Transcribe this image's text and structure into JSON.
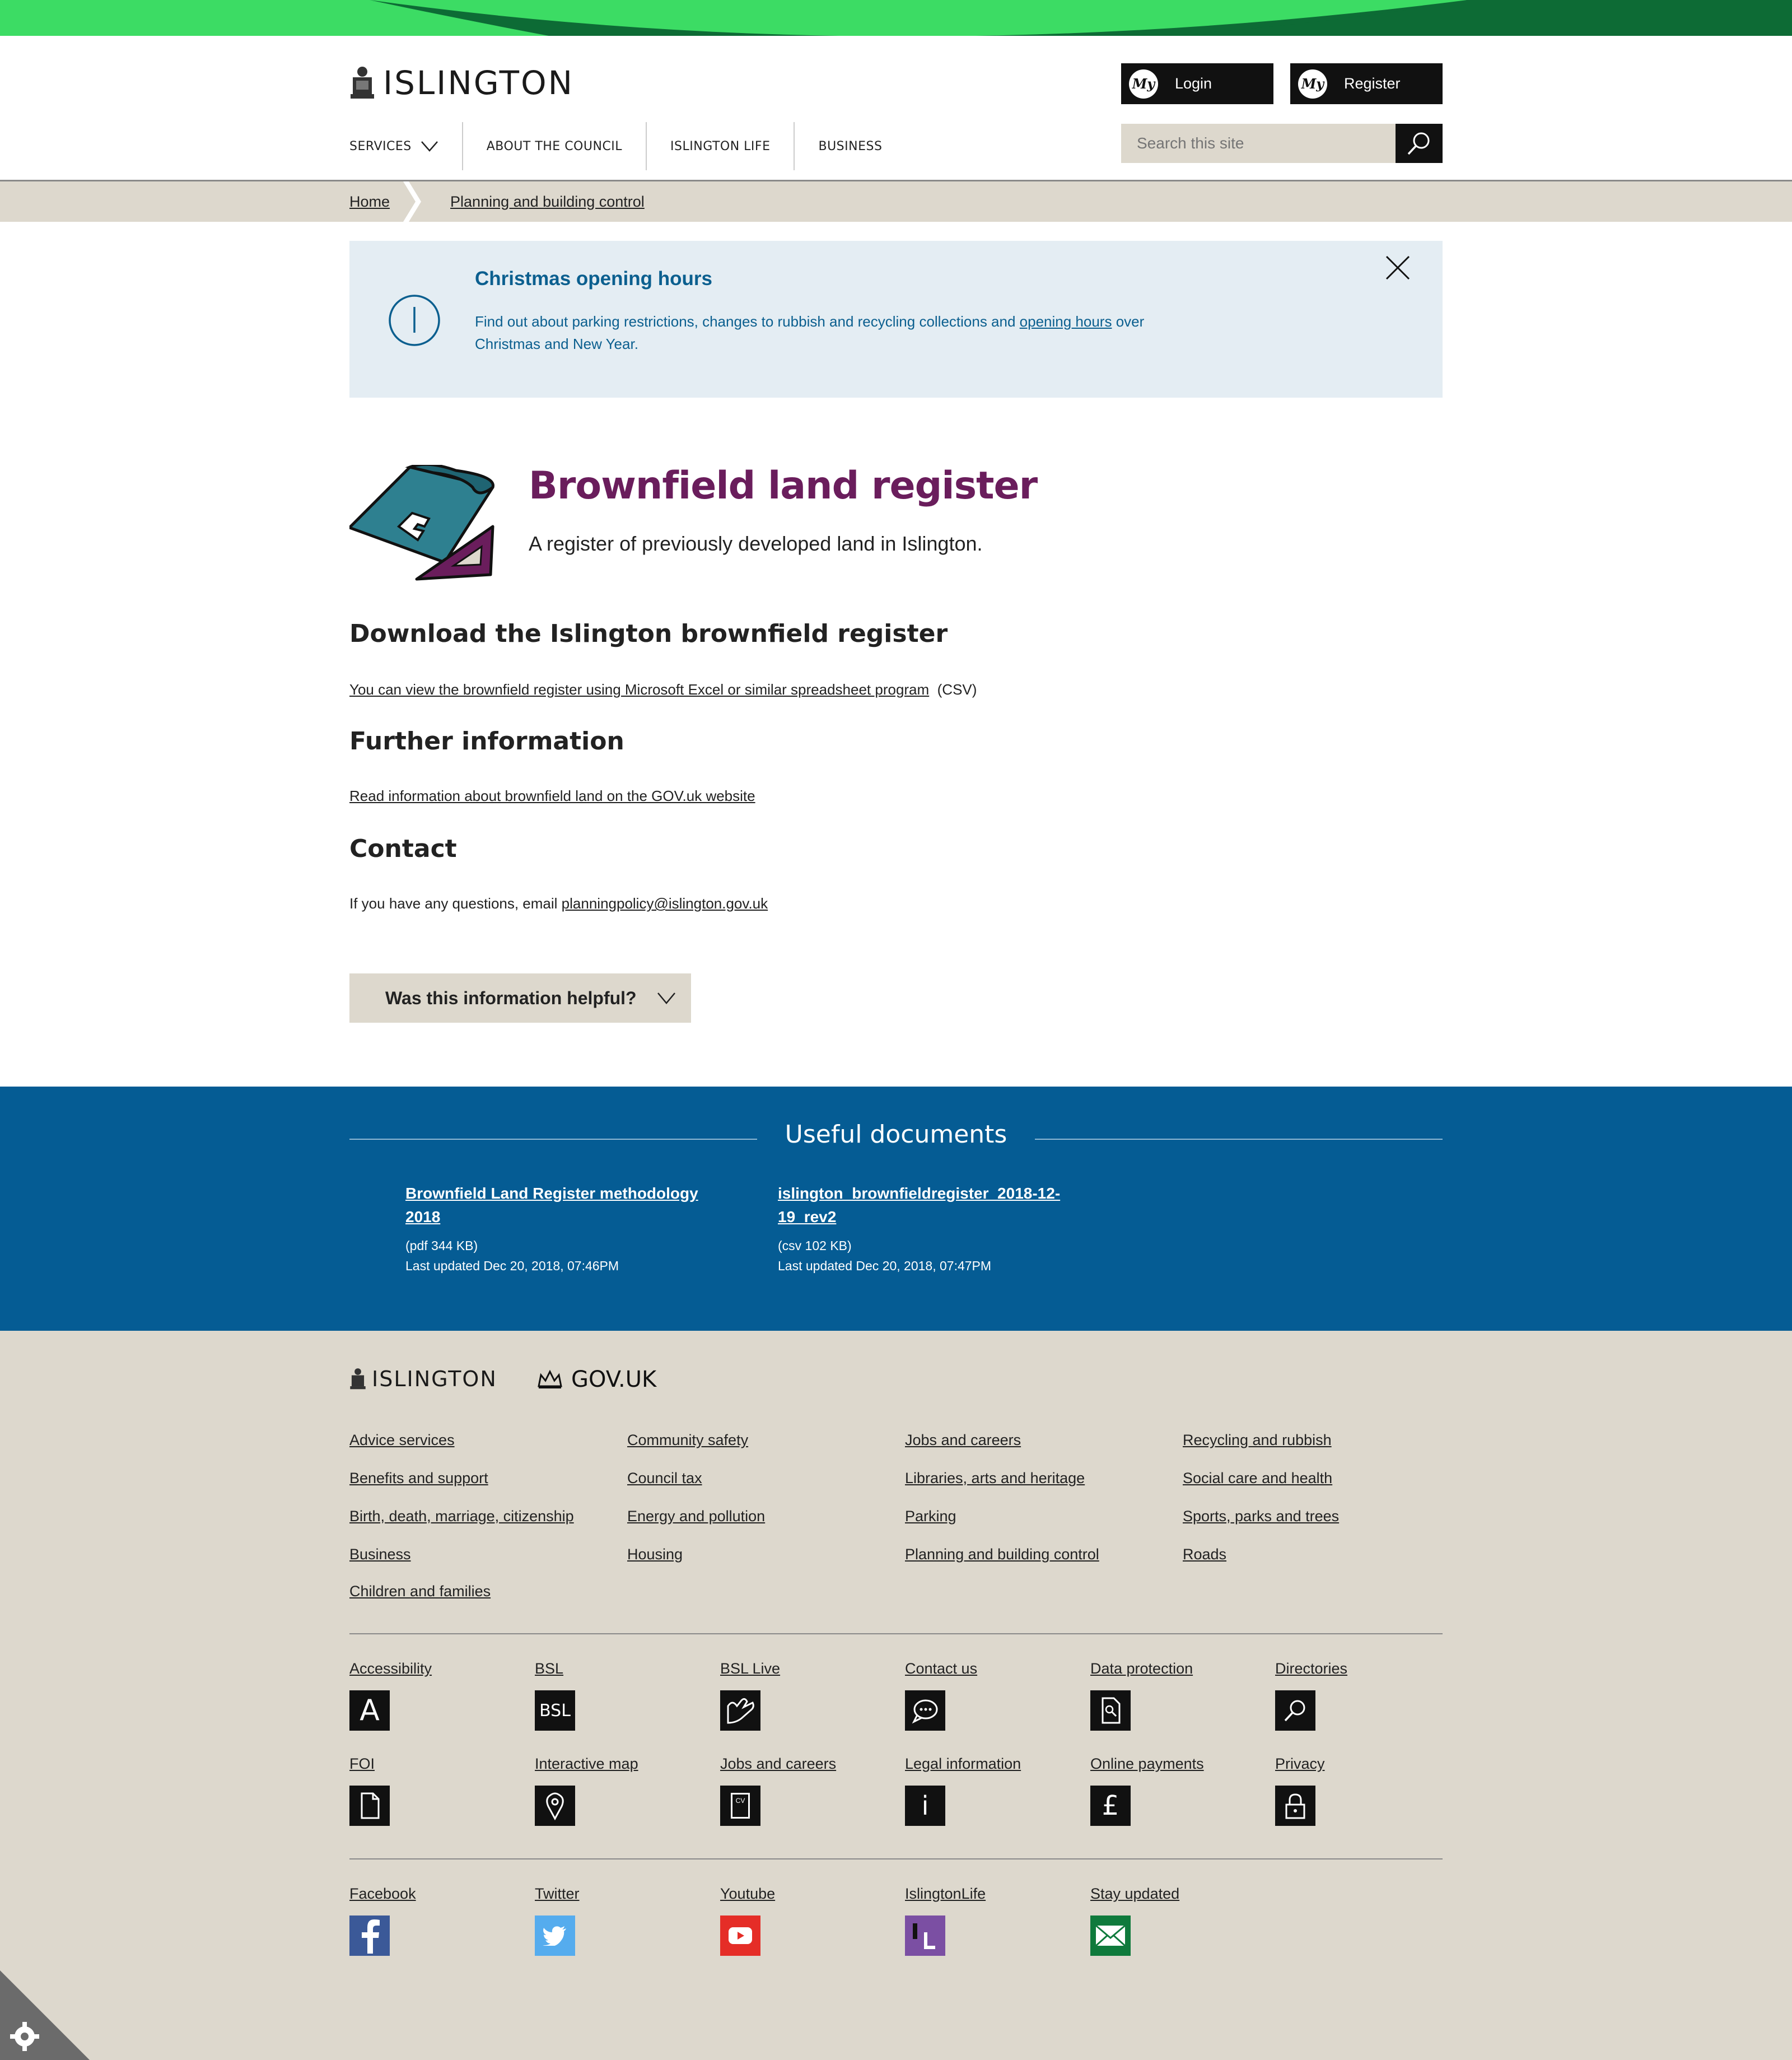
{
  "header": {
    "logo_text": "ISLINGTON",
    "login_label": "Login",
    "register_label": "Register",
    "my_badge": "My",
    "nav": [
      "SERVICES",
      "ABOUT THE COUNCIL",
      "ISLINGTON LIFE",
      "BUSINESS"
    ],
    "search_placeholder": "Search this site"
  },
  "breadcrumb": [
    "Home",
    "Planning and building control"
  ],
  "alert": {
    "title": "Christmas opening hours",
    "text_before": "Find out about parking restrictions, changes to rubbish and recycling collections and ",
    "link": "opening hours",
    "text_after": " over Christmas and New Year."
  },
  "page": {
    "title": "Brownfield land register",
    "subtitle": "A register of previously developed land in Islington.",
    "section1_heading": "Download the Islington brownfield register",
    "section1_link": "You can view the brownfield register using Microsoft Excel or similar spreadsheet program",
    "section1_suffix": "(CSV)",
    "section2_heading": "Further information",
    "section2_link": "Read information about brownfield land on the GOV.uk website",
    "section3_heading": "Contact",
    "section3_text": "If you have any questions, email ",
    "section3_email": "planningpolicy@islington.gov.uk",
    "helpful_label": "Was this information helpful?"
  },
  "documents": {
    "title": "Useful documents",
    "items": [
      {
        "name": "Brownfield Land Register methodology 2018",
        "size": "(pdf 344 KB)",
        "updated": "Last updated Dec 20, 2018, 07:46PM"
      },
      {
        "name": "islington_brownfieldregister_2018-12-19_rev2",
        "size": "(csv 102 KB)",
        "updated": "Last updated Dec 20, 2018, 07:47PM"
      }
    ]
  },
  "footer": {
    "logo_islington": "ISLINGTON",
    "logo_gov": "GOV.UK",
    "links": [
      [
        "Advice services",
        "Benefits and support",
        "Birth, death, marriage, citizenship",
        "Business",
        "Children and families"
      ],
      [
        "Community safety",
        "Council tax",
        "Energy and pollution",
        "Housing"
      ],
      [
        "Jobs and careers",
        "Libraries, arts and heritage",
        "Parking",
        "Planning and building control"
      ],
      [
        "Recycling and rubbish",
        "Social care and health",
        "Sports, parks and trees",
        "Roads"
      ]
    ],
    "quick": [
      {
        "label": "Accessibility",
        "icon": "accessibility-icon",
        "glyph": "A"
      },
      {
        "label": "BSL",
        "icon": "bsl-icon",
        "glyph": "BSL"
      },
      {
        "label": "BSL Live",
        "icon": "bsl-live-icon"
      },
      {
        "label": "Contact us",
        "icon": "speech-bubble-icon"
      },
      {
        "label": "Data protection",
        "icon": "data-protection-icon"
      },
      {
        "label": "Directories",
        "icon": "search-icon"
      },
      {
        "label": "FOI",
        "icon": "document-icon"
      },
      {
        "label": "Interactive map",
        "icon": "map-pin-icon"
      },
      {
        "label": "Jobs and careers",
        "icon": "cv-icon",
        "glyph": "CV"
      },
      {
        "label": "Legal information",
        "icon": "info-icon",
        "glyph": "i"
      },
      {
        "label": "Online payments",
        "icon": "pound-icon",
        "glyph": "£"
      },
      {
        "label": "Privacy",
        "icon": "padlock-icon"
      }
    ],
    "social": [
      {
        "label": "Facebook",
        "icon": "facebook-icon",
        "color": "#3b5998"
      },
      {
        "label": "Twitter",
        "icon": "twitter-icon",
        "color": "#55acee"
      },
      {
        "label": "Youtube",
        "icon": "youtube-icon",
        "color": "#e52d27"
      },
      {
        "label": "IslingtonLife",
        "icon": "islingtonlife-icon",
        "color": "#7b4fa3"
      },
      {
        "label": "Stay updated",
        "icon": "email-icon",
        "color": "#0f7a3c"
      }
    ]
  },
  "colors": {
    "brand_green": "#3cdc64",
    "title_purple": "#6a1d5c",
    "docs_blue": "#055c94",
    "alert_bg": "#e4edf3",
    "footer_bg": "#ddd8cd"
  }
}
